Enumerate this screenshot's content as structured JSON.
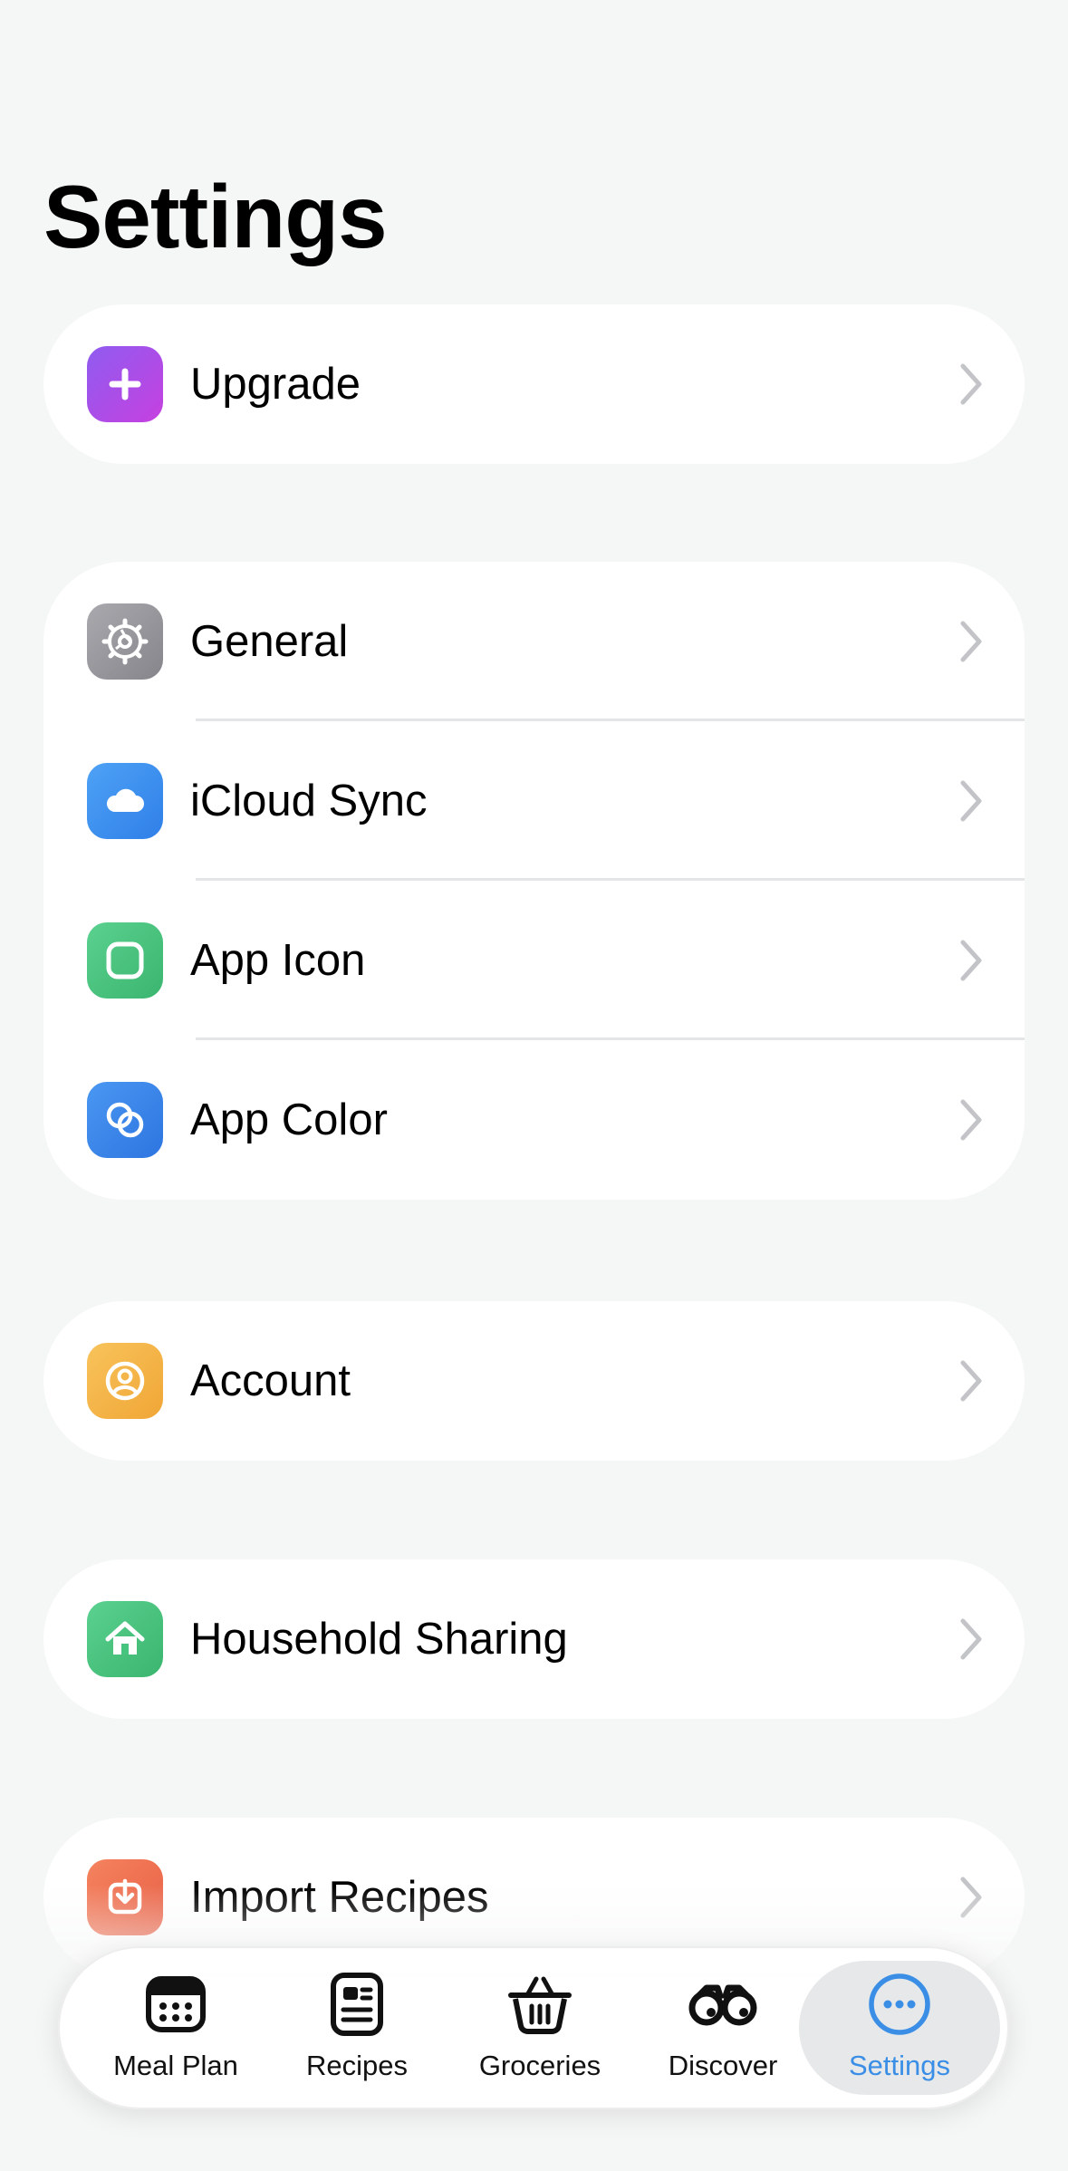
{
  "page": {
    "title": "Settings"
  },
  "sections": [
    {
      "items": [
        {
          "label": "Upgrade",
          "icon": "plus-icon",
          "color": "#b04be6"
        }
      ]
    },
    {
      "items": [
        {
          "label": "General",
          "icon": "gear-icon",
          "color": "#8e8e93"
        },
        {
          "label": "iCloud Sync",
          "icon": "cloud-icon",
          "color": "#3d8ef0"
        },
        {
          "label": "App Icon",
          "icon": "app-square-icon",
          "color": "#47c47e"
        },
        {
          "label": "App Color",
          "icon": "color-rings-icon",
          "color": "#3a86ec"
        }
      ]
    },
    {
      "items": [
        {
          "label": "Account",
          "icon": "person-circle-icon",
          "color": "#f5b342"
        }
      ]
    },
    {
      "items": [
        {
          "label": "Household Sharing",
          "icon": "house-icon",
          "color": "#47c47e"
        }
      ]
    },
    {
      "items": [
        {
          "label": "Import Recipes",
          "icon": "import-icon",
          "color": "#ef6f50"
        }
      ]
    }
  ],
  "tabbar": {
    "active": "Settings",
    "accent": "#3a8ee6",
    "tabs": [
      {
        "label": "Meal Plan",
        "icon": "calendar-icon"
      },
      {
        "label": "Recipes",
        "icon": "recipe-card-icon"
      },
      {
        "label": "Groceries",
        "icon": "basket-icon"
      },
      {
        "label": "Discover",
        "icon": "binoculars-icon"
      },
      {
        "label": "Settings",
        "icon": "more-circle-icon"
      }
    ]
  }
}
